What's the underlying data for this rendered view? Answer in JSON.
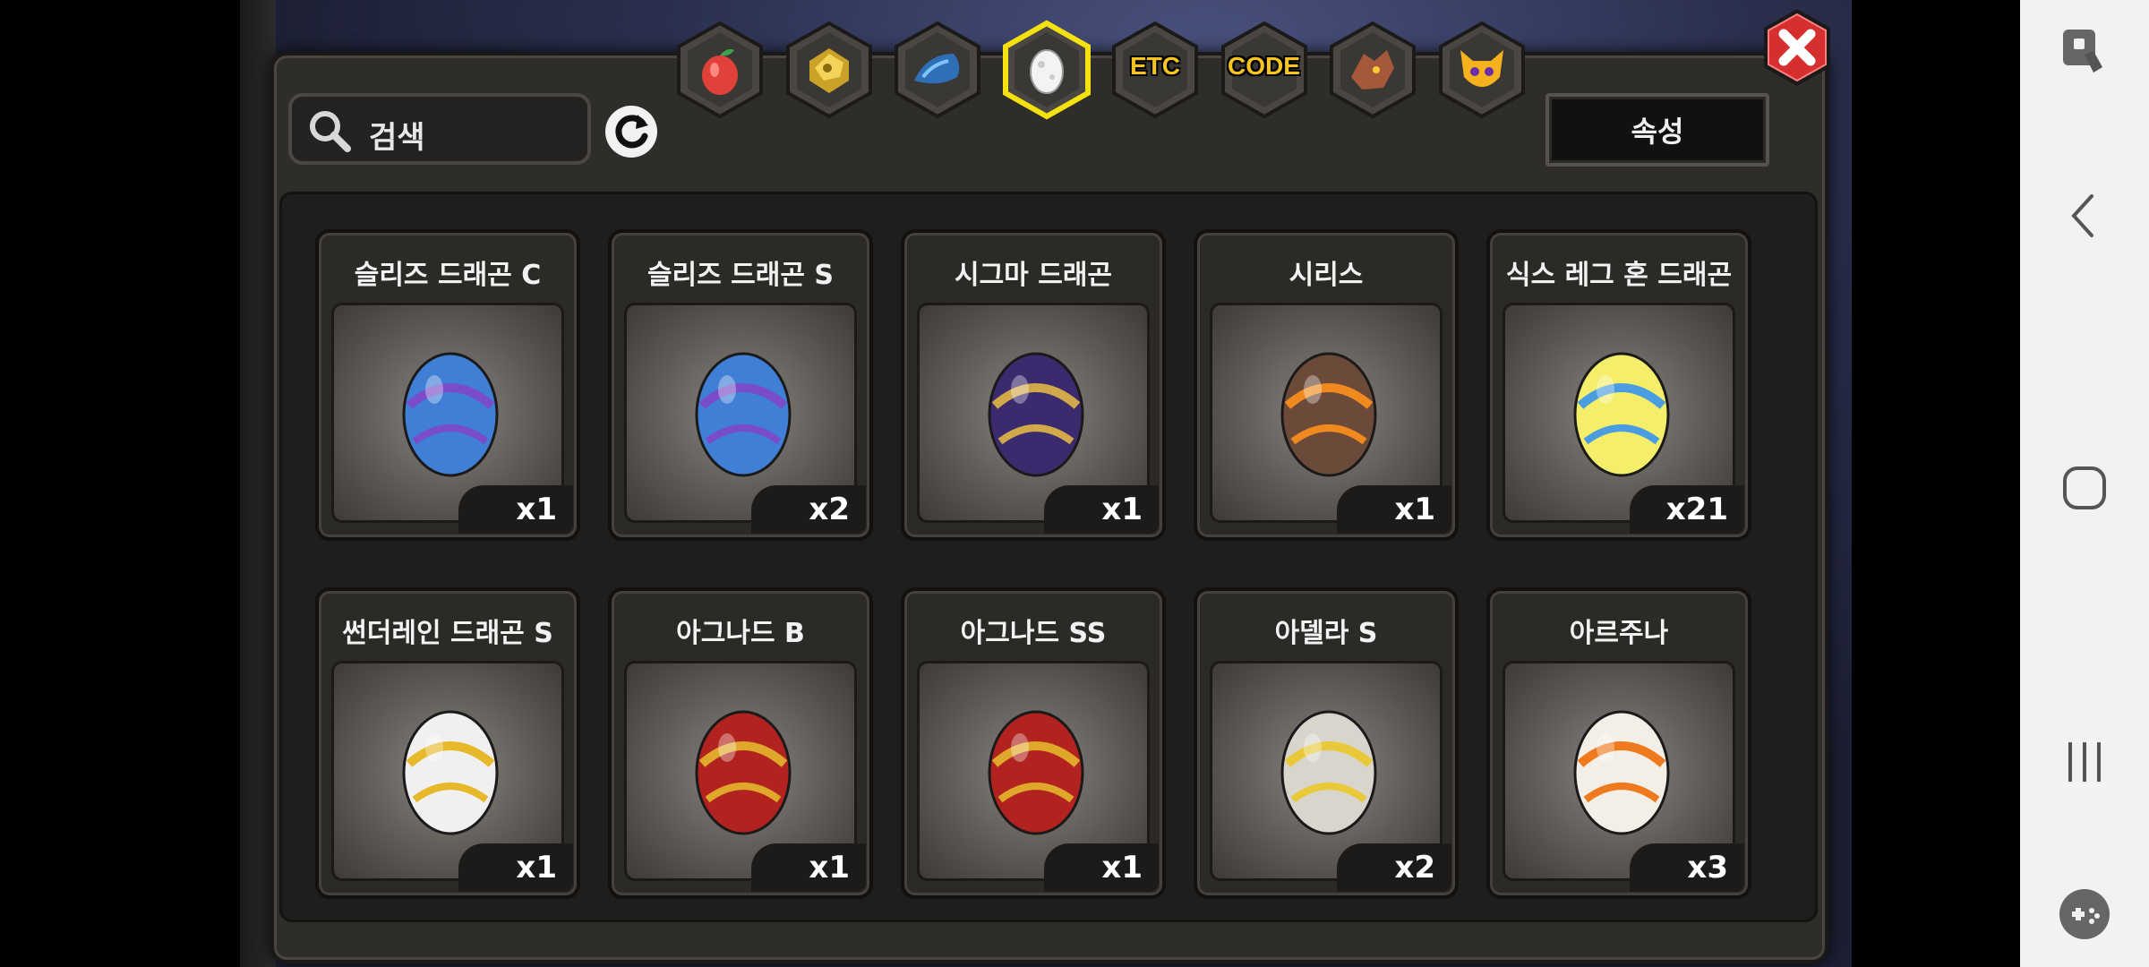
{
  "search": {
    "placeholder": "검색"
  },
  "attribute_button": {
    "label": "속성"
  },
  "tabs": [
    {
      "name": "fruit",
      "label": "",
      "icon": "fruit-icon"
    },
    {
      "name": "gold",
      "label": "",
      "icon": "gold-ore-icon"
    },
    {
      "name": "scale",
      "label": "",
      "icon": "dragon-scale-icon"
    },
    {
      "name": "egg",
      "label": "",
      "icon": "egg-icon",
      "selected": true
    },
    {
      "name": "etc",
      "label": "ETC",
      "icon": ""
    },
    {
      "name": "code",
      "label": "CODE",
      "icon": ""
    },
    {
      "name": "dragon",
      "label": "",
      "icon": "dragon-head-icon"
    },
    {
      "name": "mask",
      "label": "",
      "icon": "mask-icon"
    }
  ],
  "items": [
    {
      "name": "슬리즈 드래곤 C",
      "count": "x1",
      "egg_color": "#3f7fd6",
      "accent": "#7a4cc9"
    },
    {
      "name": "슬리즈 드래곤 S",
      "count": "x2",
      "egg_color": "#3f7fd6",
      "accent": "#7a4cc9"
    },
    {
      "name": "시그마 드래곤",
      "count": "x1",
      "egg_color": "#3b2a6e",
      "accent": "#d2a94a"
    },
    {
      "name": "시리스",
      "count": "x1",
      "egg_color": "#6b4a3a",
      "accent": "#f08a1e"
    },
    {
      "name": "식스 레그 혼 드래곤",
      "count": "x21",
      "egg_color": "#f4ee6a",
      "accent": "#4a9de0"
    },
    {
      "name": "썬더레인 드래곤 S",
      "count": "x1",
      "egg_color": "#f0f0f0",
      "accent": "#e6b82a"
    },
    {
      "name": "아그나드 B",
      "count": "x1",
      "egg_color": "#b2231f",
      "accent": "#e0a82a"
    },
    {
      "name": "아그나드 SS",
      "count": "x1",
      "egg_color": "#b2231f",
      "accent": "#e0a82a"
    },
    {
      "name": "아델라 S",
      "count": "x2",
      "egg_color": "#d8d6cc",
      "accent": "#e9c93a"
    },
    {
      "name": "아르주나",
      "count": "x3",
      "egg_color": "#f3eee6",
      "accent": "#ef7a1e"
    }
  ],
  "colors": {
    "panel": "#2f2d2a",
    "tab_selected_border": "#f5e10f",
    "close_red": "#d62f2f"
  },
  "nav_bar": {
    "buttons": [
      "screen-lock-icon",
      "back-icon",
      "home-icon",
      "recents-icon",
      "game-tools-icon"
    ]
  }
}
